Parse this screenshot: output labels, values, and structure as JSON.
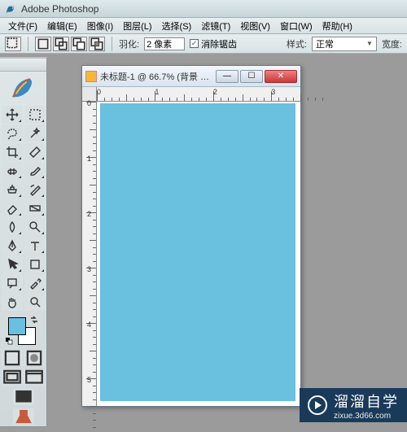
{
  "titlebar": {
    "app_name": "Adobe Photoshop"
  },
  "menu": {
    "file": "文件(F)",
    "edit": "编辑(E)",
    "image": "图像(I)",
    "layer": "图层(L)",
    "select": "选择(S)",
    "filter": "滤镜(T)",
    "view": "视图(V)",
    "window": "窗口(W)",
    "help": "帮助(H)"
  },
  "options": {
    "feather_label": "羽化:",
    "feather_value": "2 像素",
    "antialias_label": "消除锯齿",
    "antialias_checked": "✓",
    "style_label": "样式:",
    "style_value": "正常",
    "width_label": "宽度:"
  },
  "document": {
    "title": "未标题-1 @ 66.7% (背景 副...",
    "ruler_h": [
      "0",
      "1",
      "2",
      "3"
    ],
    "ruler_v": [
      "0",
      "1",
      "2",
      "3",
      "4",
      "5"
    ],
    "canvas_color": "#6ac0df"
  },
  "swatches": {
    "fg": "#6ac0df",
    "bg": "#ffffff"
  },
  "watermark": {
    "text": "溜溜自学",
    "url": "zixue.3d66.com"
  }
}
